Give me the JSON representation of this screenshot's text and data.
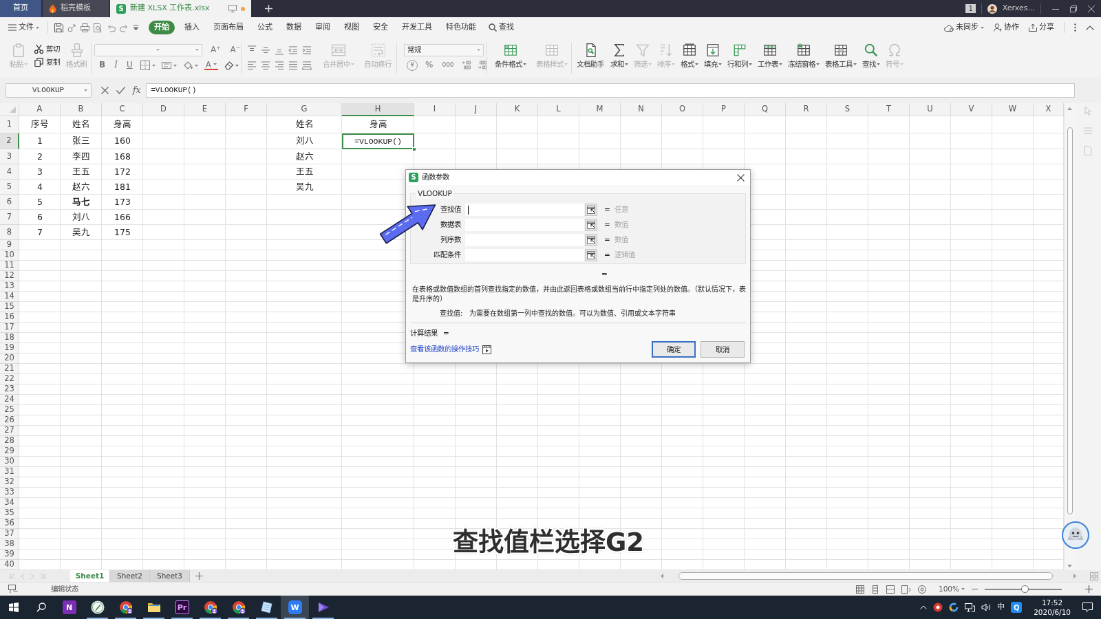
{
  "title_bar": {
    "tabs": [
      {
        "kind": "home",
        "label": "首页",
        "selected": false,
        "modified": false
      },
      {
        "kind": "template",
        "label": "稻壳模板",
        "selected": false,
        "modified": false
      },
      {
        "kind": "workbook",
        "logo": "S",
        "label": "新建 XLSX 工作表.xlsx",
        "selected": true,
        "modified": true
      }
    ],
    "window_count": "1",
    "user": "Xerxes..."
  },
  "menu_bar": {
    "file": "文件",
    "tabs": [
      {
        "label": "开始",
        "selected": true
      },
      {
        "label": "插入",
        "selected": false
      },
      {
        "label": "页面布局",
        "selected": false
      },
      {
        "label": "公式",
        "selected": false
      },
      {
        "label": "数据",
        "selected": false
      },
      {
        "label": "审阅",
        "selected": false
      },
      {
        "label": "视图",
        "selected": false
      },
      {
        "label": "安全",
        "selected": false
      },
      {
        "label": "开发工具",
        "selected": false
      },
      {
        "label": "特色功能",
        "selected": false
      }
    ],
    "search": "查找",
    "sync": "未同步",
    "collaborate": "协作",
    "share": "分享"
  },
  "ribbon": {
    "clipboard": [
      {
        "label": "粘贴",
        "disabled": true,
        "dropdown": true
      },
      {
        "label": "剪切",
        "disabled": false,
        "dropdown": false
      },
      {
        "label": "复制",
        "disabled": false,
        "dropdown": false
      },
      {
        "label": "格式刷",
        "disabled": true,
        "dropdown": false
      }
    ],
    "font_size_glyphs": [
      "A⁺",
      "A⁻"
    ],
    "style_glyphs": [
      "B",
      "I",
      "U"
    ],
    "font_color": "A",
    "alignment": [
      {
        "label": "合并居中",
        "disabled": true,
        "dropdown": true
      },
      {
        "label": "自动换行",
        "disabled": true,
        "dropdown": false
      }
    ],
    "number_format": "常规",
    "number_glyphs": [
      "¥",
      "%",
      "000"
    ],
    "styles": [
      {
        "label": "条件格式",
        "disabled": false,
        "dropdown": true
      },
      {
        "label": "表格样式",
        "disabled": true,
        "dropdown": true
      }
    ],
    "tools": [
      {
        "label": "文档助手",
        "disabled": false,
        "dropdown": false
      },
      {
        "label": "求和",
        "disabled": false,
        "dropdown": true
      },
      {
        "label": "筛选",
        "disabled": true,
        "dropdown": true
      },
      {
        "label": "排序",
        "disabled": true,
        "dropdown": true
      },
      {
        "label": "格式",
        "disabled": false,
        "dropdown": true
      },
      {
        "label": "填充",
        "disabled": false,
        "dropdown": true
      },
      {
        "label": "行和列",
        "disabled": false,
        "dropdown": true
      },
      {
        "label": "工作表",
        "disabled": false,
        "dropdown": true
      },
      {
        "label": "冻结窗格",
        "disabled": false,
        "dropdown": true
      },
      {
        "label": "表格工具",
        "disabled": false,
        "dropdown": true
      },
      {
        "label": "查找",
        "disabled": false,
        "dropdown": true
      },
      {
        "label": "符号",
        "disabled": true,
        "dropdown": true
      }
    ]
  },
  "formula_bar": {
    "name_box": "VLOOKUP",
    "function_button": "fx",
    "formula": "=VLOOKUP()"
  },
  "sheet": {
    "columns": [
      {
        "label": "A",
        "selected": false
      },
      {
        "label": "B",
        "selected": false
      },
      {
        "label": "C",
        "selected": false
      },
      {
        "label": "D",
        "selected": false
      },
      {
        "label": "E",
        "selected": false
      },
      {
        "label": "F",
        "selected": false
      },
      {
        "label": "G",
        "selected": false
      },
      {
        "label": "H",
        "selected": true
      },
      {
        "label": "I",
        "selected": false
      },
      {
        "label": "J",
        "selected": false
      },
      {
        "label": "K",
        "selected": false
      },
      {
        "label": "L",
        "selected": false
      },
      {
        "label": "M",
        "selected": false
      },
      {
        "label": "N",
        "selected": false
      },
      {
        "label": "O",
        "selected": false
      },
      {
        "label": "P",
        "selected": false
      },
      {
        "label": "Q",
        "selected": false
      },
      {
        "label": "R",
        "selected": false
      },
      {
        "label": "S",
        "selected": false
      },
      {
        "label": "T",
        "selected": false
      },
      {
        "label": "U",
        "selected": false
      },
      {
        "label": "V",
        "selected": false
      },
      {
        "label": "W",
        "selected": false
      },
      {
        "label": "X",
        "selected": false
      }
    ],
    "rows": [
      {
        "header": "1",
        "selected": false,
        "cells": {
          "A": "序号",
          "B": "姓名",
          "C": "身高",
          "G": "姓名",
          "H": "身高"
        }
      },
      {
        "header": "2",
        "selected": true,
        "cells": {
          "A": "1",
          "B": "张三",
          "C": "160",
          "G": "刘八",
          "H": "=VLOOKUP()"
        }
      },
      {
        "header": "3",
        "selected": false,
        "cells": {
          "A": "2",
          "B": "李四",
          "C": "168",
          "G": "赵六"
        }
      },
      {
        "header": "4",
        "selected": false,
        "cells": {
          "A": "3",
          "B": "王五",
          "C": "172",
          "G": "王五"
        }
      },
      {
        "header": "5",
        "selected": false,
        "cells": {
          "A": "4",
          "B": "赵六",
          "C": "181",
          "G": "吴九"
        }
      },
      {
        "header": "6",
        "selected": false,
        "cells": {
          "A": "5",
          "B": {
            "text": "马七",
            "bold": true
          },
          "C": "173"
        }
      },
      {
        "header": "7",
        "selected": false,
        "cells": {
          "A": "6",
          "B": "刘八",
          "C": "166"
        }
      },
      {
        "header": "8",
        "selected": false,
        "cells": {
          "A": "7",
          "B": "吴九",
          "C": "175"
        }
      },
      {
        "header": "9",
        "selected": false
      },
      {
        "header": "10",
        "selected": false
      },
      {
        "header": "11",
        "selected": false
      },
      {
        "header": "12",
        "selected": false
      },
      {
        "header": "13",
        "selected": false
      },
      {
        "header": "14",
        "selected": false
      },
      {
        "header": "15",
        "selected": false
      },
      {
        "header": "16",
        "selected": false
      },
      {
        "header": "17",
        "selected": false
      },
      {
        "header": "18",
        "selected": false
      },
      {
        "header": "19",
        "selected": false
      },
      {
        "header": "20",
        "selected": false
      },
      {
        "header": "21",
        "selected": false
      },
      {
        "header": "22",
        "selected": false
      },
      {
        "header": "23",
        "selected": false
      },
      {
        "header": "24",
        "selected": false
      },
      {
        "header": "25",
        "selected": false
      },
      {
        "header": "26",
        "selected": false
      },
      {
        "header": "27",
        "selected": false
      },
      {
        "header": "28",
        "selected": false
      },
      {
        "header": "29",
        "selected": false
      },
      {
        "header": "30",
        "selected": false
      },
      {
        "header": "31",
        "selected": false
      },
      {
        "header": "32",
        "selected": false
      },
      {
        "header": "33",
        "selected": false
      },
      {
        "header": "34",
        "selected": false
      },
      {
        "header": "35",
        "selected": false
      },
      {
        "header": "36",
        "selected": false
      },
      {
        "header": "37",
        "selected": false
      },
      {
        "header": "38",
        "selected": false
      },
      {
        "header": "39",
        "selected": false
      },
      {
        "header": "40",
        "selected": false
      }
    ]
  },
  "sheet_tabs": [
    {
      "label": "Sheet1",
      "selected": true
    },
    {
      "label": "Sheet2",
      "selected": false
    },
    {
      "label": "Sheet3",
      "selected": false
    }
  ],
  "status_bar": {
    "mode": "编辑状态",
    "zoom": "100%",
    "zoom_slider": {
      "level": 0.52
    }
  },
  "dialog": {
    "logo": "S",
    "title": "函数参数",
    "function_name": "VLOOKUP",
    "arguments": [
      {
        "label": "查找值",
        "focused": true,
        "equals": "=",
        "hint": "任意"
      },
      {
        "label": "数据表",
        "focused": false,
        "equals": "=",
        "hint": "数值"
      },
      {
        "label": "列序数",
        "focused": false,
        "equals": "=",
        "hint": "数值"
      },
      {
        "label": "匹配条件",
        "focused": false,
        "equals": "=",
        "hint": "逻辑值"
      }
    ],
    "result_equals": "=",
    "description": "在表格或数值数组的首列查找指定的数值，并由此返回表格或数组当前行中指定列处的数值。（默认情况下，表是升序的）",
    "argument_help": {
      "label": "查找值:",
      "text": "为需要在数组第一列中查找的数值。可以为数值、引用或文本字符串"
    },
    "result": {
      "label": "计算结果",
      "equals": "="
    },
    "help_link": "查看该函数的操作技巧",
    "buttons": [
      {
        "label": "确定",
        "default": true
      },
      {
        "label": "取消",
        "default": false
      }
    ]
  },
  "caption": "查找值栏选择G2",
  "taskbar": {
    "apps": [
      {
        "kind": "notebook",
        "badge": "N",
        "running": false,
        "selected": false
      },
      {
        "kind": "notes",
        "running": true,
        "selected": false
      },
      {
        "kind": "browser",
        "running": true,
        "selected": false
      },
      {
        "kind": "folder",
        "running": true,
        "selected": false
      },
      {
        "kind": "editor",
        "badge": "Pr",
        "running": true,
        "selected": false
      },
      {
        "kind": "browser",
        "running": true,
        "selected": false
      },
      {
        "kind": "browser",
        "running": true,
        "selected": false
      },
      {
        "kind": "pad",
        "running": true,
        "selected": false
      },
      {
        "kind": "office",
        "badge": "W",
        "running": true,
        "selected": true
      },
      {
        "kind": "player",
        "running": true,
        "selected": false
      }
    ],
    "tray": {
      "ime": "中",
      "input_badge": "Q",
      "time": "17:52",
      "date": "2020/6/10"
    }
  }
}
